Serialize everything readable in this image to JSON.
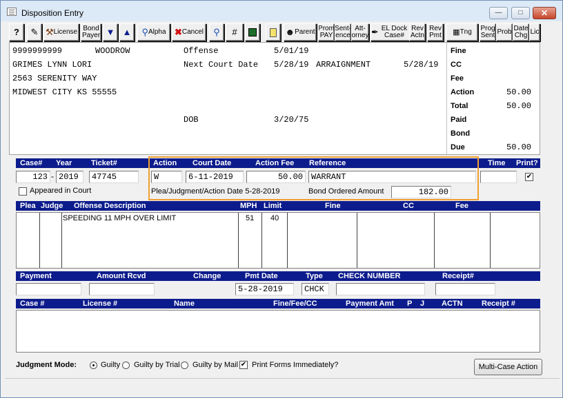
{
  "window": {
    "title": "Disposition Entry"
  },
  "toolbar": [
    {
      "name": "help-button",
      "label": "?",
      "icon": "question-icon"
    },
    {
      "name": "edit-button",
      "label": "",
      "icon": "edit-icon"
    },
    {
      "name": "license-button",
      "label": "License",
      "icon": "tools-icon"
    },
    {
      "name": "bond-payer-button",
      "label": "Bond Payer",
      "icon": ""
    },
    {
      "name": "move-down-button",
      "label": "",
      "icon": "double-down-arrow-icon"
    },
    {
      "name": "move-up-button",
      "label": "",
      "icon": "double-up-arrow-icon"
    },
    {
      "name": "alpha-button",
      "label": "Alpha",
      "icon": "magnifier-icon"
    },
    {
      "name": "cancel-button",
      "label": "Cancel",
      "icon": "red-x-icon"
    },
    {
      "name": "search-button",
      "label": "",
      "icon": "magnifier-icon"
    },
    {
      "name": "number-button",
      "label": "#",
      "icon": ""
    },
    {
      "name": "save-button",
      "label": "",
      "icon": "floppy-disk-icon"
    },
    {
      "name": "list-button",
      "label": "",
      "icon": "notepad-icon"
    },
    {
      "name": "parent-button",
      "label": "Parent",
      "icon": "people-icon"
    },
    {
      "name": "prom-pay-button",
      "label": "Prom PAY",
      "icon": ""
    },
    {
      "name": "sentence-button",
      "label": "Sent- ence",
      "icon": ""
    },
    {
      "name": "attorney-button",
      "label": "Att- orney",
      "icon": ""
    },
    {
      "name": "el-dock-case-button",
      "label": "EL Dock Case#",
      "icon": "pen-icon"
    },
    {
      "name": "rev-actn-button",
      "label": "Rev Actn",
      "icon": ""
    },
    {
      "name": "rev-pmt-button",
      "label": "Rev Pmt",
      "icon": ""
    },
    {
      "name": "tng-button",
      "label": "Tng",
      "icon": "calendar-icon"
    },
    {
      "name": "prog-sent-button",
      "label": "Prog Sent",
      "icon": ""
    },
    {
      "name": "prob-button",
      "label": "Prob",
      "icon": ""
    },
    {
      "name": "date-chg-button",
      "label": "Date Chg",
      "icon": ""
    },
    {
      "name": "lic-button",
      "label": "Lic",
      "icon": "notepad-icon"
    }
  ],
  "defendant": {
    "id": "9999999999",
    "first": "WOODROW",
    "name": "GRIMES LYNN LORI",
    "address1": "2563 SERENITY WAY",
    "address2": "MIDWEST CITY KS 55555"
  },
  "offense": {
    "offense_label": "Offense",
    "offense_date": "5/01/19",
    "next_court_label": "Next Court Date",
    "next_court_date": "5/28/19",
    "next_court_type": "ARRAIGNMENT",
    "next_court_date2": "5/28/19",
    "dob_label": "DOB",
    "dob": "3/20/75"
  },
  "totals": {
    "fine_label": "Fine",
    "cc_label": "CC",
    "fee_label": "Fee",
    "action_label": "Action",
    "action": "50.00",
    "total_label": "Total",
    "total": "50.00",
    "paid_label": "Paid",
    "bond_label": "Bond",
    "due_label": "Due",
    "due": "50.00"
  },
  "case_header": {
    "case": "Case#",
    "year": "Year",
    "ticket": "Ticket#",
    "action": "Action",
    "court_date": "Court Date",
    "action_fee": "Action Fee",
    "reference": "Reference",
    "time": "Time",
    "print": "Print?"
  },
  "case_values": {
    "case_num": "123",
    "year": "2019",
    "ticket": "47745",
    "action": "W",
    "court_date": "6-11-2019",
    "action_fee": "50.00",
    "reference": "WARRANT",
    "time": "",
    "print_checked": "✔"
  },
  "appeared_label": "Appeared in Court",
  "plea_date_label": "Plea/Judgment/Action Date 5-28-2019",
  "bond_ordered_label": "Bond Ordered Amount",
  "bond_ordered": "182.00",
  "offense_header": {
    "plea": "Plea",
    "judge": "Judge",
    "desc": "Offense Description",
    "mph": "MPH",
    "limit": "Limit",
    "fine": "Fine",
    "cc": "CC",
    "fee": "Fee"
  },
  "offense_row": {
    "desc": "SPEEDING 11 MPH OVER LIMIT",
    "mph": "51",
    "limit": "40"
  },
  "payment_header": {
    "payment": "Payment",
    "amount": "Amount Rcvd",
    "change": "Change",
    "pmt_date": "Pmt Date",
    "type": "Type",
    "check": "CHECK NUMBER",
    "receipt": "Receipt#"
  },
  "payment_values": {
    "pmt_date": "5-28-2019",
    "type": "CHCK"
  },
  "history_header": {
    "case": "Case #",
    "license": "License #",
    "name": "Name",
    "fine": "Fine/Fee/CC",
    "payment": "Payment Amt",
    "p": "P",
    "j": "J",
    "actn": "ACTN",
    "receipt": "Receipt #"
  },
  "footer": {
    "judgment_mode_label": "Judgment Mode:",
    "guilty": "Guilty",
    "guilty_trial": "Guilty by Trial",
    "guilty_mail": "Guilty by Mail",
    "print_forms": "Print Forms Immediately?",
    "multi_case": "Multi-Case Action"
  },
  "colors": {
    "header_bar": "#0d1c8c",
    "highlight": "#f0a030"
  }
}
